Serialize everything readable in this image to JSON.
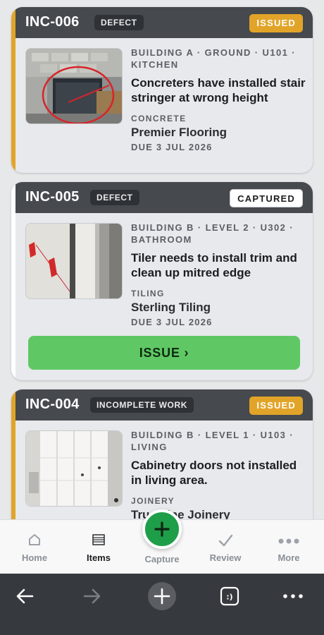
{
  "items": [
    {
      "id": "INC-006",
      "type": "DEFECT",
      "status": "ISSUED",
      "location": "BUILDING A · GROUND · U101 · KITCHEN",
      "description": "Concreters have installed stair stringer at wrong height",
      "trade": "CONCRETE",
      "company": "Premier Flooring",
      "due": "DUE 3 JUL 2026"
    },
    {
      "id": "INC-005",
      "type": "DEFECT",
      "status": "CAPTURED",
      "location": "BUILDING B · LEVEL 2 · U302 · BATHROOM",
      "description": "Tiler needs to install trim and clean up mitred edge",
      "trade": "TILING",
      "company": "Sterling Tiling",
      "due": "DUE 3 JUL 2026",
      "action": "ISSUE ›"
    },
    {
      "id": "INC-004",
      "type": "INCOMPLETE WORK",
      "status": "ISSUED",
      "location": "BUILDING B · LEVEL 1 · U103 · LIVING",
      "description": "Cabinetry doors not installed in living area.",
      "trade": "JOINERY",
      "company": "True Line Joinery"
    }
  ],
  "nav": {
    "home": "Home",
    "items": "Items",
    "capture": "Capture",
    "review": "Review",
    "more": "More",
    "active": "items"
  },
  "colors": {
    "issued": "#e2a428",
    "action_green": "#5fc864",
    "capture_fab": "#1e9e48",
    "header_dark": "#46494e"
  },
  "icons": {
    "home": "home-icon",
    "items": "list-icon",
    "capture": "plus-icon",
    "review": "checkmark-icon",
    "more": "ellipsis-icon",
    "browser": [
      "back-arrow-icon",
      "forward-arrow-icon",
      "new-tab-plus-icon",
      "tab-switcher-icon",
      "menu-dots-icon"
    ]
  }
}
